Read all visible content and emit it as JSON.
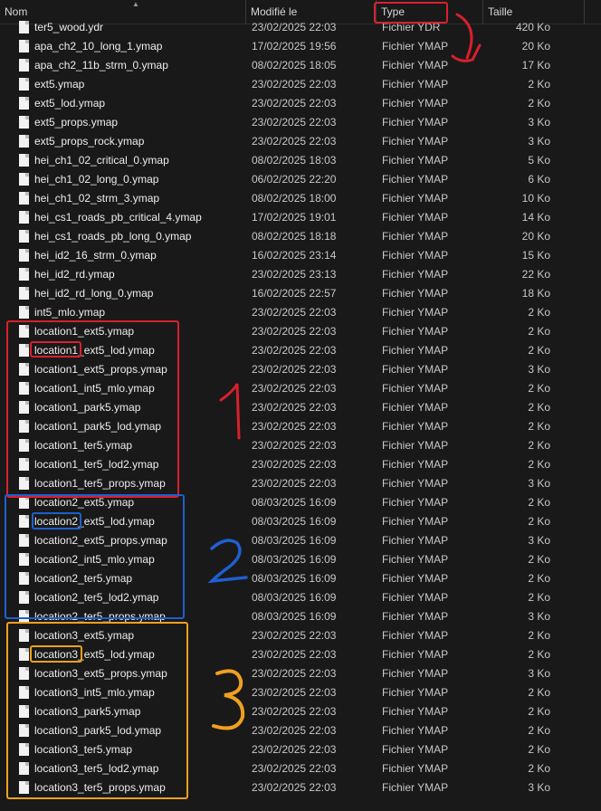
{
  "columns": {
    "name": "Nom",
    "modified": "Modifié le",
    "type": "Type",
    "size": "Taille"
  },
  "files": [
    {
      "name": "ter5_wood.ydr",
      "date": "23/02/2025 22:03",
      "type": "Fichier YDR",
      "size": "420 Ko"
    },
    {
      "name": "apa_ch2_10_long_1.ymap",
      "date": "17/02/2025 19:56",
      "type": "Fichier YMAP",
      "size": "20 Ko"
    },
    {
      "name": "apa_ch2_11b_strm_0.ymap",
      "date": "08/02/2025 18:05",
      "type": "Fichier YMAP",
      "size": "17 Ko"
    },
    {
      "name": "ext5.ymap",
      "date": "23/02/2025 22:03",
      "type": "Fichier YMAP",
      "size": "2 Ko"
    },
    {
      "name": "ext5_lod.ymap",
      "date": "23/02/2025 22:03",
      "type": "Fichier YMAP",
      "size": "2 Ko"
    },
    {
      "name": "ext5_props.ymap",
      "date": "23/02/2025 22:03",
      "type": "Fichier YMAP",
      "size": "3 Ko"
    },
    {
      "name": "ext5_props_rock.ymap",
      "date": "23/02/2025 22:03",
      "type": "Fichier YMAP",
      "size": "3 Ko"
    },
    {
      "name": "hei_ch1_02_critical_0.ymap",
      "date": "08/02/2025 18:03",
      "type": "Fichier YMAP",
      "size": "5 Ko"
    },
    {
      "name": "hei_ch1_02_long_0.ymap",
      "date": "06/02/2025 22:20",
      "type": "Fichier YMAP",
      "size": "6 Ko"
    },
    {
      "name": "hei_ch1_02_strm_3.ymap",
      "date": "08/02/2025 18:00",
      "type": "Fichier YMAP",
      "size": "10 Ko"
    },
    {
      "name": "hei_cs1_roads_pb_critical_4.ymap",
      "date": "17/02/2025 19:01",
      "type": "Fichier YMAP",
      "size": "14 Ko"
    },
    {
      "name": "hei_cs1_roads_pb_long_0.ymap",
      "date": "08/02/2025 18:18",
      "type": "Fichier YMAP",
      "size": "20 Ko"
    },
    {
      "name": "hei_id2_16_strm_0.ymap",
      "date": "16/02/2025 23:14",
      "type": "Fichier YMAP",
      "size": "15 Ko"
    },
    {
      "name": "hei_id2_rd.ymap",
      "date": "23/02/2025 23:13",
      "type": "Fichier YMAP",
      "size": "22 Ko"
    },
    {
      "name": "hei_id2_rd_long_0.ymap",
      "date": "16/02/2025 22:57",
      "type": "Fichier YMAP",
      "size": "18 Ko"
    },
    {
      "name": "int5_mlo.ymap",
      "date": "23/02/2025 22:03",
      "type": "Fichier YMAP",
      "size": "2 Ko"
    },
    {
      "name": "location1_ext5.ymap",
      "date": "23/02/2025 22:03",
      "type": "Fichier YMAP",
      "size": "2 Ko"
    },
    {
      "name": "location1_ext5_lod.ymap",
      "date": "23/02/2025 22:03",
      "type": "Fichier YMAP",
      "size": "2 Ko"
    },
    {
      "name": "location1_ext5_props.ymap",
      "date": "23/02/2025 22:03",
      "type": "Fichier YMAP",
      "size": "3 Ko"
    },
    {
      "name": "location1_int5_mlo.ymap",
      "date": "23/02/2025 22:03",
      "type": "Fichier YMAP",
      "size": "2 Ko"
    },
    {
      "name": "location1_park5.ymap",
      "date": "23/02/2025 22:03",
      "type": "Fichier YMAP",
      "size": "2 Ko"
    },
    {
      "name": "location1_park5_lod.ymap",
      "date": "23/02/2025 22:03",
      "type": "Fichier YMAP",
      "size": "2 Ko"
    },
    {
      "name": "location1_ter5.ymap",
      "date": "23/02/2025 22:03",
      "type": "Fichier YMAP",
      "size": "2 Ko"
    },
    {
      "name": "location1_ter5_lod2.ymap",
      "date": "23/02/2025 22:03",
      "type": "Fichier YMAP",
      "size": "2 Ko"
    },
    {
      "name": "location1_ter5_props.ymap",
      "date": "23/02/2025 22:03",
      "type": "Fichier YMAP",
      "size": "3 Ko"
    },
    {
      "name": "location2_ext5.ymap",
      "date": "08/03/2025 16:09",
      "type": "Fichier YMAP",
      "size": "2 Ko"
    },
    {
      "name": "location2_ext5_lod.ymap",
      "date": "08/03/2025 16:09",
      "type": "Fichier YMAP",
      "size": "2 Ko"
    },
    {
      "name": "location2_ext5_props.ymap",
      "date": "08/03/2025 16:09",
      "type": "Fichier YMAP",
      "size": "3 Ko"
    },
    {
      "name": "location2_int5_mlo.ymap",
      "date": "08/03/2025 16:09",
      "type": "Fichier YMAP",
      "size": "2 Ko"
    },
    {
      "name": "location2_ter5.ymap",
      "date": "08/03/2025 16:09",
      "type": "Fichier YMAP",
      "size": "2 Ko"
    },
    {
      "name": "location2_ter5_lod2.ymap",
      "date": "08/03/2025 16:09",
      "type": "Fichier YMAP",
      "size": "2 Ko"
    },
    {
      "name": "location2_ter5_props.ymap",
      "date": "08/03/2025 16:09",
      "type": "Fichier YMAP",
      "size": "3 Ko"
    },
    {
      "name": "location3_ext5.ymap",
      "date": "23/02/2025 22:03",
      "type": "Fichier YMAP",
      "size": "2 Ko"
    },
    {
      "name": "location3_ext5_lod.ymap",
      "date": "23/02/2025 22:03",
      "type": "Fichier YMAP",
      "size": "2 Ko"
    },
    {
      "name": "location3_ext5_props.ymap",
      "date": "23/02/2025 22:03",
      "type": "Fichier YMAP",
      "size": "3 Ko"
    },
    {
      "name": "location3_int5_mlo.ymap",
      "date": "23/02/2025 22:03",
      "type": "Fichier YMAP",
      "size": "2 Ko"
    },
    {
      "name": "location3_park5.ymap",
      "date": "23/02/2025 22:03",
      "type": "Fichier YMAP",
      "size": "2 Ko"
    },
    {
      "name": "location3_park5_lod.ymap",
      "date": "23/02/2025 22:03",
      "type": "Fichier YMAP",
      "size": "2 Ko"
    },
    {
      "name": "location3_ter5.ymap",
      "date": "23/02/2025 22:03",
      "type": "Fichier YMAP",
      "size": "2 Ko"
    },
    {
      "name": "location3_ter5_lod2.ymap",
      "date": "23/02/2025 22:03",
      "type": "Fichier YMAP",
      "size": "2 Ko"
    },
    {
      "name": "location3_ter5_props.ymap",
      "date": "23/02/2025 22:03",
      "type": "Fichier YMAP",
      "size": "3 Ko"
    }
  ],
  "annotations": {
    "colors": {
      "red": "#d8202c",
      "blue": "#1f5fcf",
      "orange": "#f0a020"
    },
    "labels": {
      "group1": "1",
      "group2": "2",
      "group3": "3"
    }
  }
}
